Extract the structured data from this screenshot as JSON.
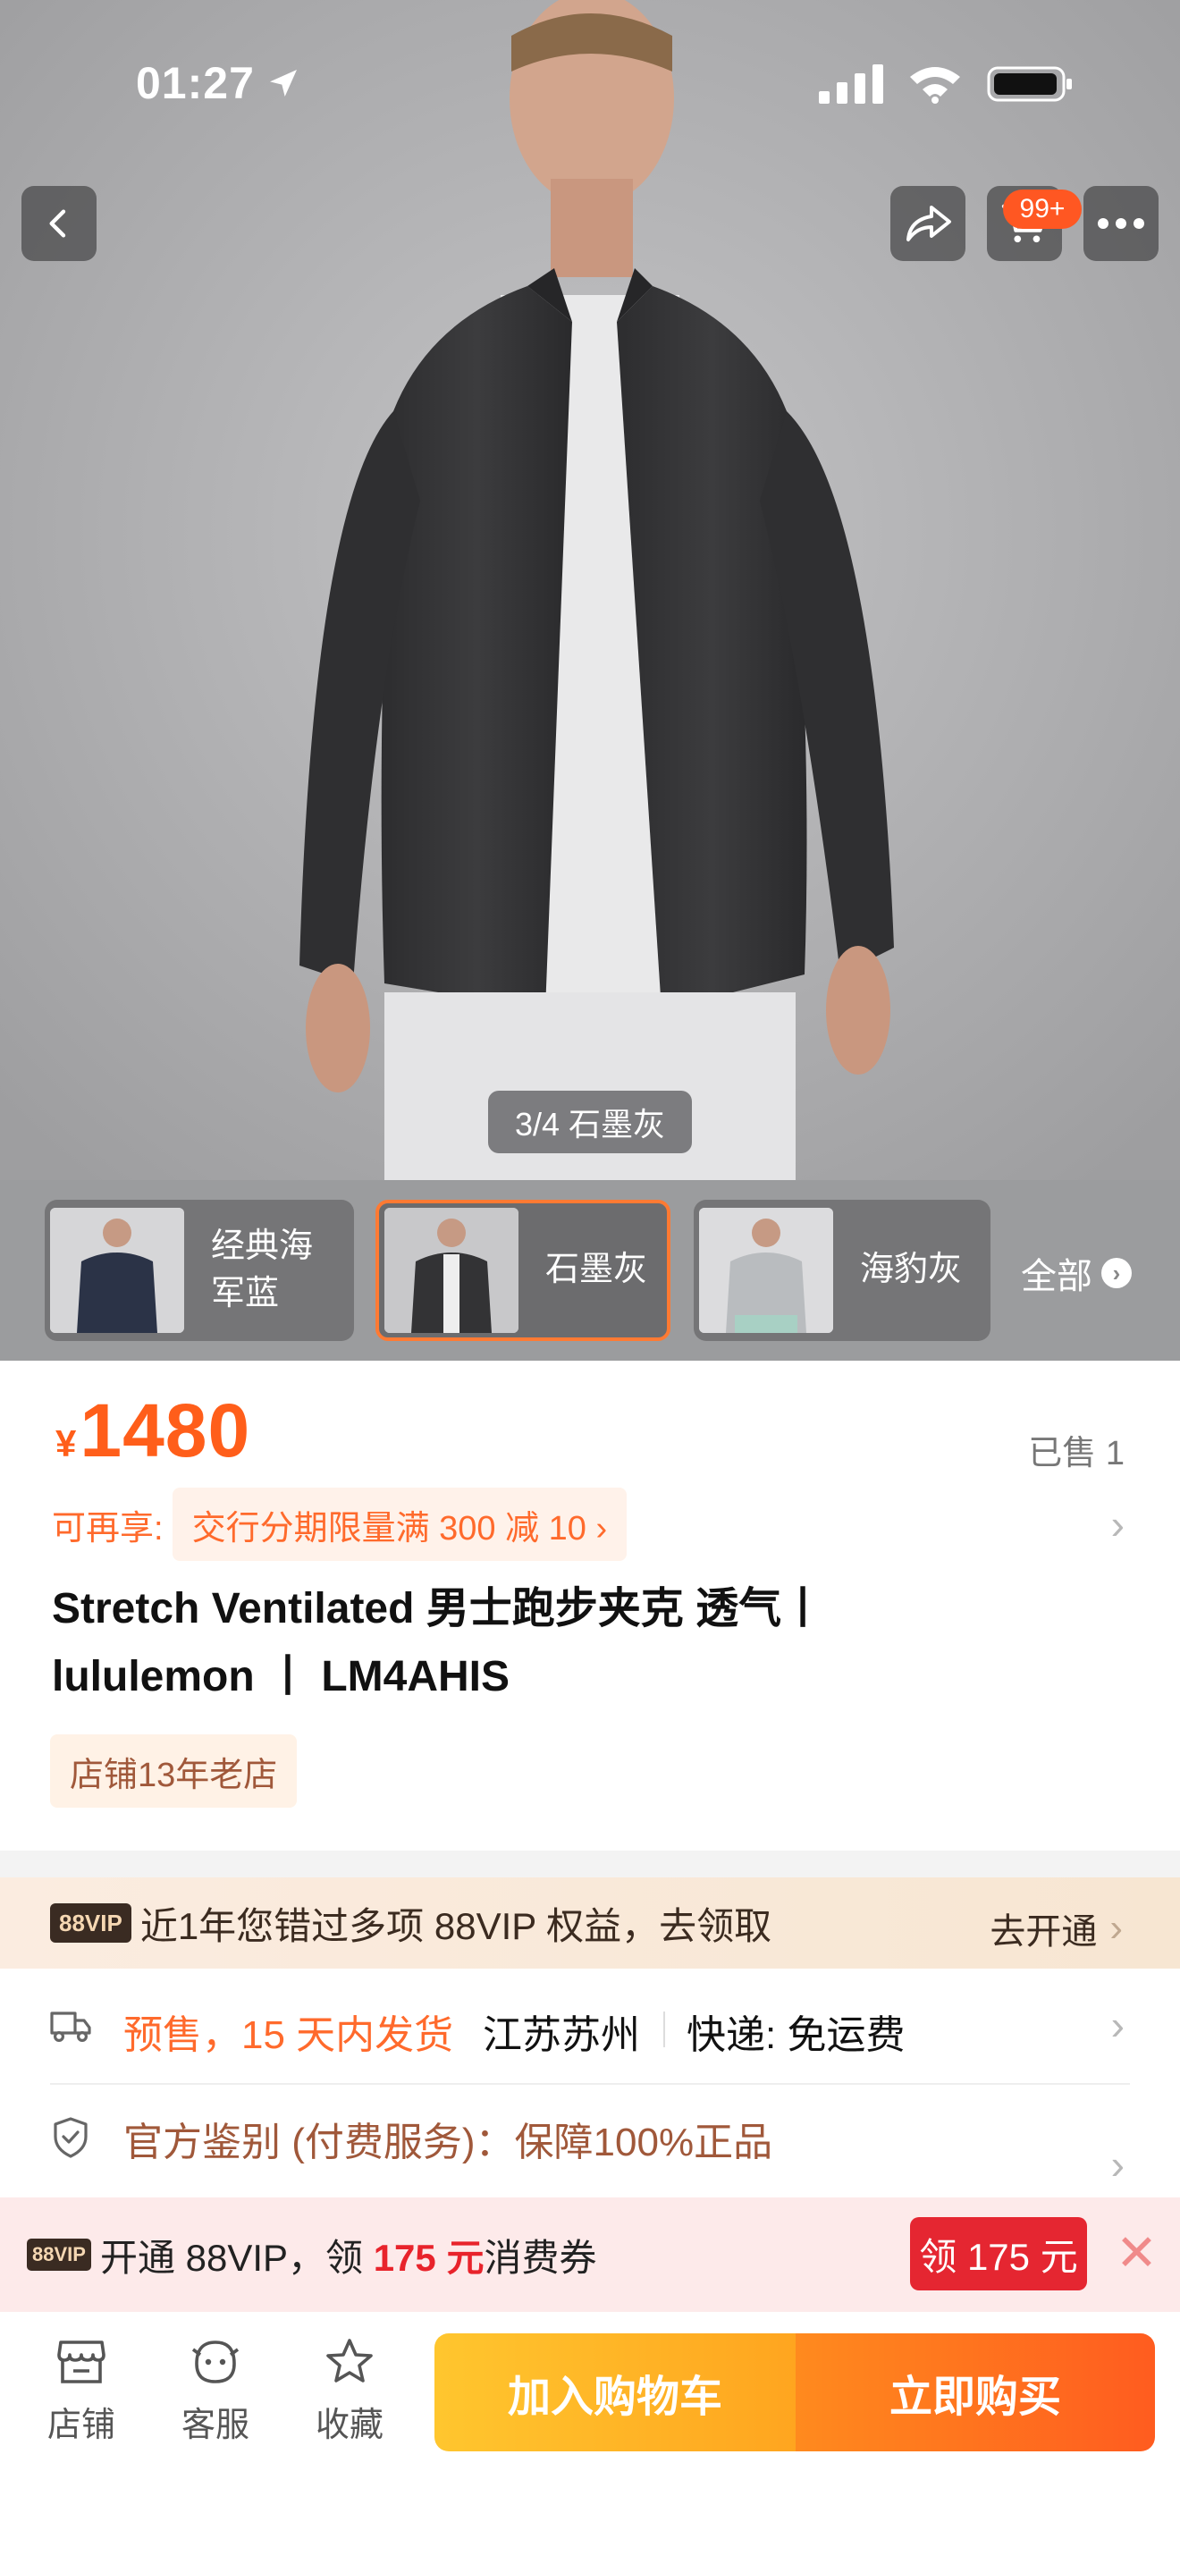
{
  "status_bar": {
    "time": "01:27"
  },
  "hero": {
    "image_counter": "3/4 石墨灰",
    "cart_badge": "99+"
  },
  "variants": {
    "items": [
      {
        "label": "经典海军蓝"
      },
      {
        "label": "石墨灰",
        "selected": true
      },
      {
        "label": "海豹灰"
      }
    ],
    "see_all": "全部"
  },
  "product": {
    "currency": "¥",
    "price": "1480",
    "sold": "已售 1",
    "promo_label": "可再享:",
    "promo_text": "交行分期限量满 300 减 10 ›",
    "title_line1": "Stretch Ventilated 男士跑步夹克 透气丨",
    "title_line2": "lululemon 丨 LM4AHIS",
    "shop_tag": "店铺13年老店"
  },
  "vip_bar": {
    "chip": "88VIP",
    "text": "近1年您错过多项 88VIP 权益，去领取",
    "action": "去开通"
  },
  "shipping": {
    "presale": "预售，15 天内发货",
    "origin": "江苏苏州",
    "express": "快递: 免运费",
    "guarantee": "官方鉴别 (付费服务)：保障100%正品"
  },
  "coupon_bar": {
    "chip": "88VIP",
    "text_prefix": "开通 88VIP，领 ",
    "amount": "175 元",
    "text_suffix": "消费券",
    "button": "领 175 元"
  },
  "tabbar": {
    "shop": "店铺",
    "service": "客服",
    "favorite": "收藏",
    "add_to_cart": "加入购物车",
    "buy_now": "立即购买"
  },
  "colors": {
    "accent": "#ff5e1a",
    "coupon_red": "#e52631",
    "cart_yellow": "#ffb320"
  }
}
